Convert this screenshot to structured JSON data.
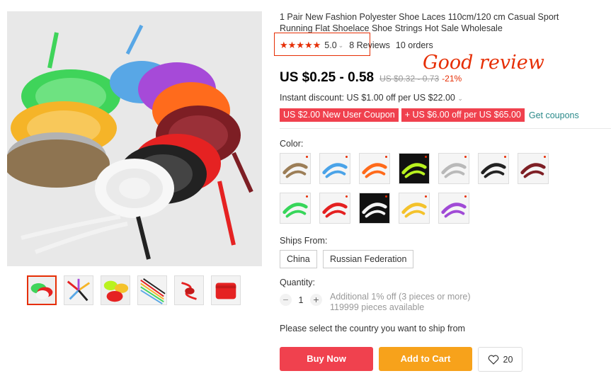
{
  "product": {
    "title": "1 Pair New Fashion Polyester Shoe Laces 110cm/120 cm Casual Sport Running Flat Shoelace Shoe Strings Hot Sale Wholesale",
    "stars": "★★★★★",
    "rating": "5.0",
    "reviews": "8 Reviews",
    "orders": "10 orders",
    "annotation": "Good review",
    "price": "US $0.25 - 0.58",
    "old_price": "US $0.32 - 0.73",
    "discount": "-21%",
    "instant_discount": "Instant discount: US $1.00 off per US $22.00",
    "coupons": [
      "US $2.00 New User Coupon",
      "+ US $6.00 off per US $65.00"
    ],
    "get_coupons": "Get coupons"
  },
  "color": {
    "label": "Color:",
    "swatches": [
      {
        "name": "khaki",
        "hex": "#9c7e57"
      },
      {
        "name": "sky-blue",
        "hex": "#4aa3e8"
      },
      {
        "name": "orange",
        "hex": "#ff6a1a"
      },
      {
        "name": "fluorescent-green",
        "hex": "#b9f21f"
      },
      {
        "name": "light-gray",
        "hex": "#b9b9b9"
      },
      {
        "name": "black",
        "hex": "#222222"
      },
      {
        "name": "wine-red",
        "hex": "#7e1f25"
      },
      {
        "name": "green",
        "hex": "#37d65a"
      },
      {
        "name": "red",
        "hex": "#e42020"
      },
      {
        "name": "white",
        "hex": "#f5f5f5"
      },
      {
        "name": "yellow",
        "hex": "#f4c22b"
      },
      {
        "name": "purple",
        "hex": "#a04ad6"
      }
    ]
  },
  "ships_from": {
    "label": "Ships From:",
    "options": [
      "China",
      "Russian Federation"
    ]
  },
  "quantity": {
    "label": "Quantity:",
    "minus": "−",
    "value": "1",
    "plus": "+",
    "additional": "Additional 1% off (3 pieces or more)",
    "available": "119999 pieces available"
  },
  "country_note": "Please select the country you want to ship from",
  "actions": {
    "buy_now": "Buy Now",
    "add_to_cart": "Add to Cart",
    "wishlist_count": "20"
  },
  "icons": {
    "heart": "heart-icon",
    "caret": "chevron-down-icon"
  },
  "colors": {
    "accent": "#e62e04",
    "buy": "#f0414e",
    "cart": "#f7a21b",
    "link": "#2a8a8a"
  }
}
